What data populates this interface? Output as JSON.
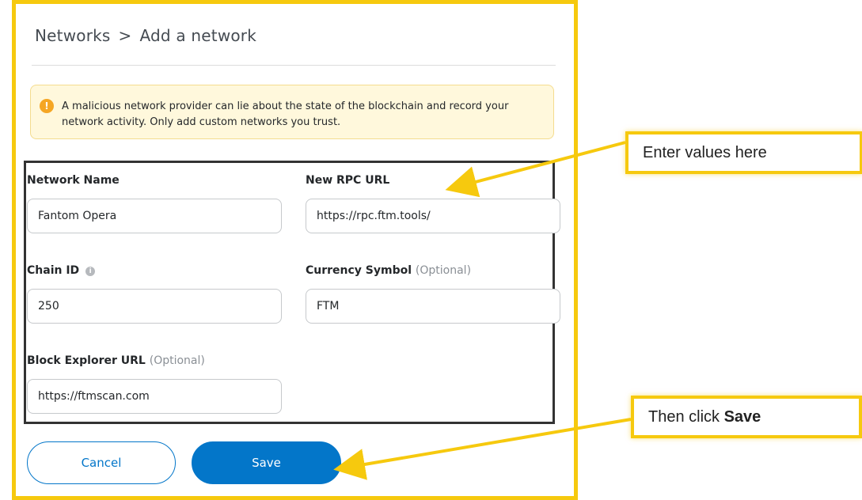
{
  "breadcrumb": {
    "parent": "Networks",
    "separator": ">",
    "current": "Add a network"
  },
  "warning": {
    "icon": "info-icon",
    "text": "A malicious network provider can lie about the state of the blockchain and record your network activity. Only add custom networks you trust."
  },
  "form": {
    "network_name": {
      "label": "Network Name",
      "value": "Fantom Opera"
    },
    "rpc_url": {
      "label": "New RPC URL",
      "value": "https://rpc.ftm.tools/"
    },
    "chain_id": {
      "label": "Chain ID",
      "value": "250"
    },
    "currency_symbol": {
      "label": "Currency Symbol",
      "optional": "(Optional)",
      "value": "FTM"
    },
    "block_explorer": {
      "label": "Block Explorer URL",
      "optional": "(Optional)",
      "value": "https://ftmscan.com"
    }
  },
  "buttons": {
    "cancel": "Cancel",
    "save": "Save"
  },
  "annotations": {
    "enter_values": "Enter values here",
    "then_click_prefix": "Then click ",
    "then_click_bold": "Save"
  },
  "colors": {
    "highlight": "#f6c90e",
    "primary": "#0376c9",
    "warning_bg": "#fff8dc",
    "warning_icon": "#f5a623"
  }
}
